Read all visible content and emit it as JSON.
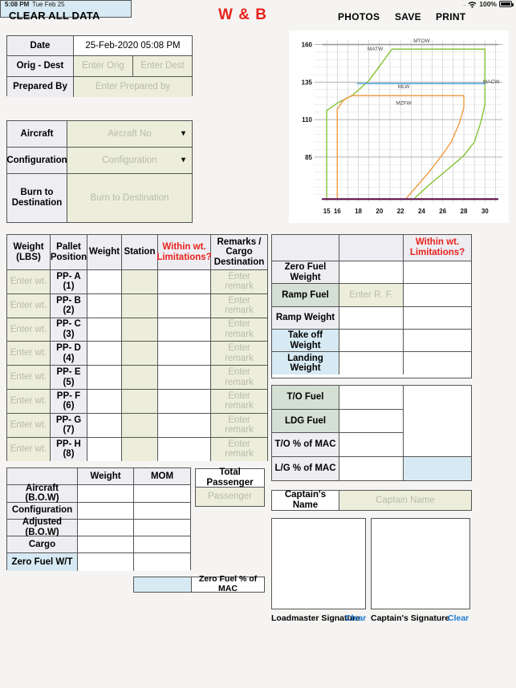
{
  "statusbar": {
    "time": "5:08 PM",
    "date": "Tue Feb 25",
    "dots": "....",
    "wifi_icon": "wifi-icon",
    "battery_pct": "100%",
    "battery_icon": "battery-full-icon"
  },
  "header": {
    "clear_all": "CLEAR ALL DATA",
    "title": "W & B",
    "photos": "PHOTOS",
    "save": "SAVE",
    "print": "PRINT"
  },
  "info1": {
    "date_label": "Date",
    "date_value": "25-Feb-2020 05:08 PM",
    "orig_dest_label": "Orig - Dest",
    "orig_placeholder": "Enter Orig",
    "dest_placeholder": "Enter Dest",
    "prepared_label": "Prepared By",
    "prepared_placeholder": "Enter Prepared by"
  },
  "info2": {
    "aircraft_label": "Aircraft",
    "aircraft_placeholder": "Aircraft No",
    "configuration_label": "Configuration",
    "configuration_placeholder": "Configuration",
    "burn_label": "Burn to Destination",
    "burn_placeholder": "Burn to Destination",
    "caret": "⌄"
  },
  "chart_data": {
    "type": "line",
    "title": "",
    "xlabel": "",
    "ylabel": "",
    "xlim": [
      14,
      31.5
    ],
    "ylim": [
      55,
      163
    ],
    "xticks": [
      15,
      16,
      18,
      20,
      22,
      24,
      26,
      28,
      30
    ],
    "yticks": [
      160,
      135,
      110,
      85
    ],
    "grid": true,
    "legend": "inline-annotations",
    "annotations": [
      {
        "text": "MTOW",
        "x": 24.0,
        "y": 161.5
      },
      {
        "text": "MATW",
        "x": 19.6,
        "y": 156.0
      },
      {
        "text": "MACW",
        "x": 30.6,
        "y": 134.0
      },
      {
        "text": "MLW",
        "x": 22.3,
        "y": 131.0
      },
      {
        "text": "MZFW",
        "x": 22.3,
        "y": 120.0
      }
    ],
    "series": [
      {
        "name": "MATW / MTOW / MACW envelope",
        "color": "#8dc63f",
        "points": [
          [
            15.0,
            58.0
          ],
          [
            15.0,
            116.0
          ],
          [
            16.0,
            121.0
          ],
          [
            17.5,
            126.5
          ],
          [
            19.0,
            136.0
          ],
          [
            21.2,
            157.0
          ],
          [
            28.0,
            157.0
          ],
          [
            30.0,
            157.0
          ],
          [
            30.0,
            120.0
          ],
          [
            29.6,
            108.0
          ],
          [
            29.0,
            95.0
          ],
          [
            28.0,
            86.0
          ],
          [
            26.5,
            77.0
          ],
          [
            24.8,
            67.0
          ],
          [
            23.4,
            58.0
          ]
        ]
      },
      {
        "name": "MZFW envelope",
        "color": "#f0a04b",
        "color_alt": "#f7b267",
        "points": [
          [
            16.0,
            58.0
          ],
          [
            16.0,
            117.0
          ],
          [
            16.6,
            123.0
          ],
          [
            17.4,
            126.0
          ],
          [
            22.0,
            126.0
          ],
          [
            28.0,
            126.0
          ],
          [
            28.0,
            118.0
          ],
          [
            27.6,
            108.0
          ],
          [
            26.8,
            95.0
          ],
          [
            25.8,
            85.0
          ],
          [
            24.7,
            75.0
          ],
          [
            23.6,
            66.0
          ],
          [
            22.6,
            58.0
          ]
        ]
      },
      {
        "name": "MLW",
        "color": "#4fa3dd",
        "points": [
          [
            17.9,
            134.0
          ],
          [
            30.0,
            134.0
          ]
        ]
      },
      {
        "name": "MTOW cap",
        "color": "#9a9a9a",
        "points": [
          [
            14.6,
            160.0
          ],
          [
            31.2,
            160.0
          ]
        ]
      },
      {
        "name": "baseline",
        "color": "#5c0d4a",
        "points": [
          [
            14.6,
            57.0
          ],
          [
            31.2,
            57.0
          ]
        ]
      }
    ]
  },
  "pallet_table": {
    "headers": [
      "Weight (LBS)",
      "Pallet Position",
      "Weight",
      "Station",
      "Within wt. Limitations?",
      "Remarks / Cargo Destination"
    ],
    "weight_placeholder": "Enter wt.",
    "remark_placeholder": "Enter remark",
    "rows": [
      {
        "position": "PP- A (1)"
      },
      {
        "position": "PP- B (2)"
      },
      {
        "position": "PP- C (3)"
      },
      {
        "position": "PP- D (4)"
      },
      {
        "position": "PP- E (5)"
      },
      {
        "position": "PP- F (6)"
      },
      {
        "position": "PP- G (7)"
      },
      {
        "position": "PP- H (8)"
      }
    ]
  },
  "bow_table": {
    "headers": [
      "",
      "Weight",
      "MOM"
    ],
    "rows": [
      {
        "label": "Aircraft (B.O.W)"
      },
      {
        "label": "Configuration"
      },
      {
        "label": "Adjusted (B.O.W)"
      },
      {
        "label": "Cargo"
      },
      {
        "label": "Zero Fuel W/T"
      }
    ]
  },
  "total_passenger": {
    "label": "Total Passenger",
    "placeholder": "Passenger"
  },
  "zero_fuel_mac": {
    "label": "Zero Fuel % of MAC"
  },
  "weight_table": {
    "header_blank": "",
    "header_within": "Within wt. Limitations?",
    "rows": [
      {
        "label": "Zero Fuel Weight"
      },
      {
        "label": "Ramp Fuel",
        "placeholder": "Enter R. F."
      },
      {
        "label": "Ramp Weight"
      },
      {
        "label": "Take off Weight"
      },
      {
        "label": "Landing Weight"
      }
    ]
  },
  "fuel_table": {
    "rows": [
      {
        "label": "T/O Fuel"
      },
      {
        "label": "LDG Fuel"
      },
      {
        "label": "T/O % of MAC"
      },
      {
        "label": "L/G % of MAC"
      }
    ]
  },
  "captain": {
    "label": "Captain's Name",
    "placeholder": "Captain Name"
  },
  "signatures": {
    "loadmaster_label": "Loadmaster Signature",
    "captain_label": "Captain's Signature",
    "clear_label": "Clear"
  }
}
